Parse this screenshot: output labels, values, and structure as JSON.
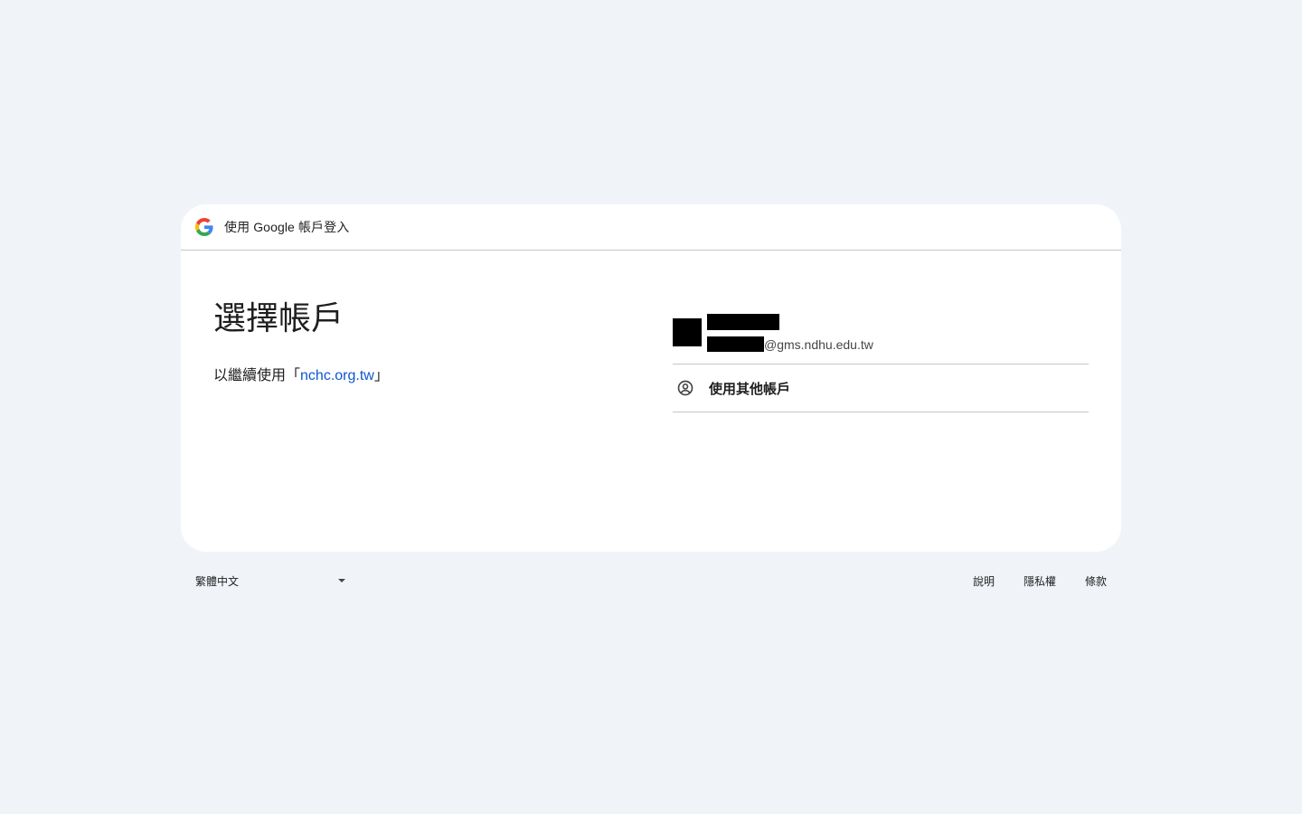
{
  "header": {
    "title": "使用 Google 帳戶登入",
    "logo_icon": "google-g-icon"
  },
  "main": {
    "heading": "選擇帳戶",
    "subtext_prefix": "以繼續使用「",
    "app_link": "nchc.org.tw",
    "subtext_suffix": "」"
  },
  "accounts": [
    {
      "email_domain": "@gms.ndhu.edu.tw"
    }
  ],
  "other_account": {
    "label": "使用其他帳戶",
    "icon": "account-circle-icon"
  },
  "footer": {
    "language": "繁體中文",
    "links": [
      "說明",
      "隱私權",
      "條款"
    ]
  },
  "colors": {
    "background": "#f0f4f9",
    "card": "#ffffff",
    "link": "#0b57d0",
    "divider": "#c4c7c5"
  }
}
